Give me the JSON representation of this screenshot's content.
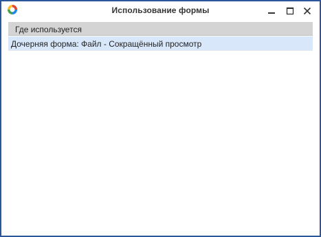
{
  "window": {
    "title": "Использование формы",
    "border_color": "#2b579a",
    "logo_icon": "app-logo-icon"
  },
  "title_buttons": {
    "minimize_icon": "minimize-icon",
    "maximize_icon": "maximize-icon",
    "close_icon": "close-icon"
  },
  "grid": {
    "columns": [
      {
        "label": "Где используется"
      }
    ],
    "rows": [
      {
        "cells": [
          "Дочерняя форма: Файл - Сокращённый просмотр"
        ],
        "selected": true
      }
    ],
    "header_bg": "#d4d4d4",
    "selected_row_bg": "#d8e7fa"
  }
}
